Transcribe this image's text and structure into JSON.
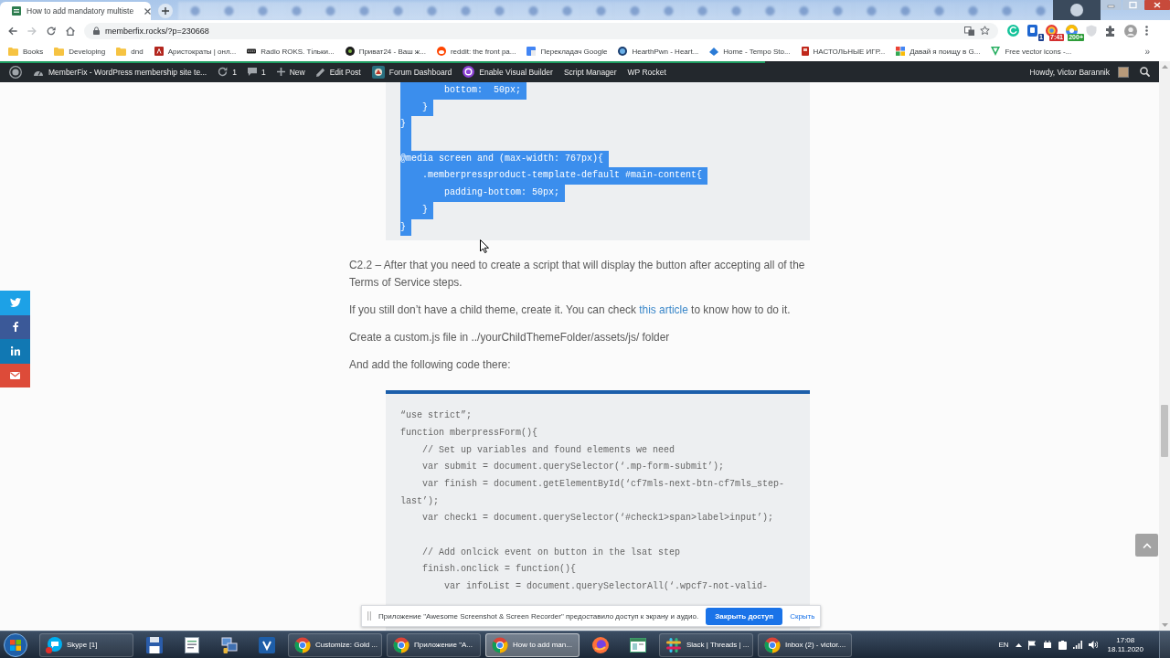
{
  "browser": {
    "tabs": [
      {
        "title": "How to add mandatory multiste",
        "selected": true
      }
    ],
    "navigation": [
      {
        "kind": "back",
        "disabled": false
      },
      {
        "kind": "forward",
        "disabled": true
      },
      {
        "kind": "reload",
        "disabled": false
      },
      {
        "kind": "home",
        "disabled": false
      }
    ],
    "address": "memberfix.rocks/?p=230668",
    "extension_badges": [
      {
        "text": "1",
        "color": "#1b3f8f"
      },
      {
        "text": "7:41",
        "color": "#d32f2f"
      },
      {
        "text": "200+",
        "color": "#2e9d3a"
      }
    ],
    "bookmarks": [
      {
        "label": "Books",
        "kind": "folder"
      },
      {
        "label": "Developing",
        "kind": "folder"
      },
      {
        "label": "dnd",
        "kind": "folder"
      },
      {
        "label": "Аристократы | онл...",
        "kind": "site"
      },
      {
        "label": "Radio ROKS. Тільки...",
        "kind": "site"
      },
      {
        "label": "Приват24 - Ваш ж...",
        "kind": "site"
      },
      {
        "label": "reddit: the front pa...",
        "kind": "site"
      },
      {
        "label": "Перекладач Google",
        "kind": "site"
      },
      {
        "label": "HearthPwn - Heart...",
        "kind": "site"
      },
      {
        "label": "Home - Tempo Sto...",
        "kind": "site"
      },
      {
        "label": "НАСТОЛЬНЫЕ ИГР...",
        "kind": "site"
      },
      {
        "label": "Давай я поищу в G...",
        "kind": "site"
      },
      {
        "label": "Free vector icons -...",
        "kind": "site"
      }
    ],
    "bookmarks_more": "»"
  },
  "admin_bar": {
    "loading": {
      "level": 0.66
    },
    "site_name": "MemberFix - WordPress membership site te...",
    "updates": "1",
    "comments": "1",
    "new_label": "New",
    "edit_label": "Edit Post",
    "menu": [
      {
        "label": "Forum Dashboard",
        "kind": "forum"
      },
      {
        "label": "Enable Visual Builder",
        "kind": "builder"
      },
      {
        "label": "Script Manager",
        "kind": "plain"
      },
      {
        "label": "WP Rocket",
        "kind": "plain"
      }
    ],
    "greeting": "Howdy, Victor Barannik"
  },
  "article": {
    "blocks": [
      {
        "kind": "code",
        "accent_bar": false,
        "lines": [
          {
            "kind": "text",
            "text": "        bottom:  50px;",
            "selected": true
          },
          {
            "kind": "text",
            "text": "    }",
            "selected": true
          },
          {
            "kind": "text",
            "text": "}",
            "selected": true
          },
          {
            "kind": "blank",
            "selected": true
          },
          {
            "kind": "text",
            "text": "@media screen and (max-width: 767px){",
            "selected": true
          },
          {
            "kind": "text",
            "text": "    .memberpressproduct-template-default #main-content{",
            "selected": true
          },
          {
            "kind": "text",
            "text": "        padding-bottom: 50px;",
            "selected": true
          },
          {
            "kind": "text",
            "text": "    }",
            "selected": true
          },
          {
            "kind": "text",
            "text": "}",
            "selected": true
          }
        ]
      },
      {
        "kind": "paragraph",
        "parts": [
          {
            "kind": "text",
            "text": "C2.2 – After that you need to create a script that will display the button after accepting all of the Terms of Service steps."
          }
        ]
      },
      {
        "kind": "paragraph",
        "parts": [
          {
            "kind": "text",
            "text": "If you still don’t have a child theme, create it. You can check "
          },
          {
            "kind": "link",
            "text": "this article"
          },
          {
            "kind": "text",
            "text": " to know how to do it."
          }
        ]
      },
      {
        "kind": "paragraph",
        "parts": [
          {
            "kind": "text",
            "text": "Create a custom.js file in ../yourChildThemeFolder/assets/js/ folder"
          }
        ]
      },
      {
        "kind": "paragraph",
        "parts": [
          {
            "kind": "text",
            "text": "And add the following code there:"
          }
        ]
      },
      {
        "kind": "code",
        "accent_bar": true,
        "lines": [
          {
            "kind": "text",
            "text": "“use strict”;",
            "selected": false
          },
          {
            "kind": "text",
            "text": "function mberpressForm(){",
            "selected": false
          },
          {
            "kind": "text",
            "text": "    // Set up variables and found elements we need",
            "selected": false
          },
          {
            "kind": "text",
            "text": "    var submit = document.querySelector(‘.mp-form-submit’);",
            "selected": false
          },
          {
            "kind": "text",
            "text": "    var finish = document.getElementById(‘cf7mls-next-btn-cf7mls_step-",
            "selected": false
          },
          {
            "kind": "text",
            "text": "last’);",
            "selected": false
          },
          {
            "kind": "text",
            "text": "    var check1 = document.querySelector(‘#check1>span>label>input’);",
            "selected": false
          },
          {
            "kind": "blank",
            "selected": false
          },
          {
            "kind": "text",
            "text": "    // Add onlcick event on button in the lsat step",
            "selected": false
          },
          {
            "kind": "text",
            "text": "    finish.onclick = function(){",
            "selected": false
          },
          {
            "kind": "text",
            "text": "        var infoList = document.querySelectorAll(‘.wpcf7-not-valid-",
            "selected": false
          }
        ]
      }
    ]
  },
  "share_buttons": [
    {
      "kind": "twitter"
    },
    {
      "kind": "facebook"
    },
    {
      "kind": "linkedin"
    },
    {
      "kind": "email"
    }
  ],
  "notification": {
    "text": "Приложение \"Awesome Screenshot & Screen Recorder\" предоставило доступ к экрану и аудио.",
    "button": "Закрыть доступ",
    "dismiss": "Скрыть"
  },
  "taskbar": {
    "items": [
      {
        "kind": "skype",
        "label": "Skype [1]",
        "selected": false
      },
      {
        "kind": "disk",
        "selected": false
      },
      {
        "kind": "document",
        "selected": false
      },
      {
        "kind": "network",
        "selected": false
      },
      {
        "kind": "editor",
        "selected": false
      },
      {
        "kind": "chrome",
        "label": "Customize: Gold ...",
        "selected": false
      },
      {
        "kind": "chrome",
        "label": "Приложение \"A...",
        "selected": false
      },
      {
        "kind": "chrome",
        "label": "How to add man...",
        "selected": true
      },
      {
        "kind": "firefox",
        "selected": false
      },
      {
        "kind": "window",
        "selected": false
      },
      {
        "kind": "slack",
        "label": "Slack | Threads | ...",
        "selected": false
      },
      {
        "kind": "chrome",
        "label": "Inbox (2) - victor....",
        "selected": false
      }
    ],
    "language": "EN",
    "time": "17:08",
    "date": "18.11.2020"
  }
}
